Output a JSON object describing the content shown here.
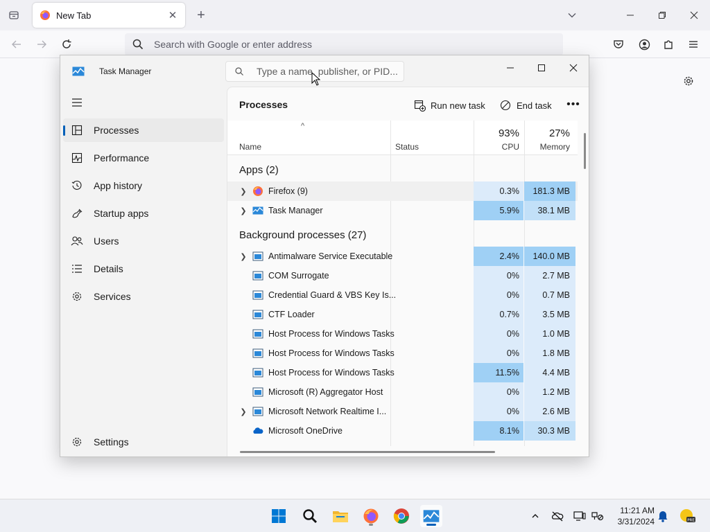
{
  "browser": {
    "tab_title": "New Tab",
    "url_placeholder": "Search with Google or enter address"
  },
  "task_manager": {
    "title": "Task Manager",
    "search_placeholder": "Type a name, publisher, or PID...",
    "nav": [
      {
        "label": "Processes",
        "icon": "processes-icon"
      },
      {
        "label": "Performance",
        "icon": "performance-icon"
      },
      {
        "label": "App history",
        "icon": "app-history-icon"
      },
      {
        "label": "Startup apps",
        "icon": "startup-apps-icon"
      },
      {
        "label": "Users",
        "icon": "users-icon"
      },
      {
        "label": "Details",
        "icon": "details-icon"
      },
      {
        "label": "Services",
        "icon": "services-icon"
      }
    ],
    "settings_label": "Settings",
    "page_title": "Processes",
    "run_new_task": "Run new task",
    "end_task": "End task",
    "columns": {
      "name": "Name",
      "status": "Status",
      "cpu_pct": "93%",
      "cpu": "CPU",
      "memory_pct": "27%",
      "memory": "Memory"
    },
    "groups": {
      "apps": "Apps (2)",
      "background": "Background processes (27)"
    },
    "apps": [
      {
        "name": "Firefox (9)",
        "cpu": "0.3%",
        "mem": "181.3 MB",
        "icon": "firefox-icon",
        "expandable": true
      },
      {
        "name": "Task Manager",
        "cpu": "5.9%",
        "mem": "38.1 MB",
        "icon": "task-manager-icon",
        "expandable": true
      }
    ],
    "background": [
      {
        "name": "Antimalware Service Executable",
        "cpu": "2.4%",
        "mem": "140.0 MB",
        "expandable": true
      },
      {
        "name": "COM Surrogate",
        "cpu": "0%",
        "mem": "2.7 MB",
        "expandable": false
      },
      {
        "name": "Credential Guard & VBS Key Is...",
        "cpu": "0%",
        "mem": "0.7 MB",
        "expandable": false
      },
      {
        "name": "CTF Loader",
        "cpu": "0.7%",
        "mem": "3.5 MB",
        "expandable": false
      },
      {
        "name": "Host Process for Windows Tasks",
        "cpu": "0%",
        "mem": "1.0 MB",
        "expandable": false
      },
      {
        "name": "Host Process for Windows Tasks",
        "cpu": "0%",
        "mem": "1.8 MB",
        "expandable": false
      },
      {
        "name": "Host Process for Windows Tasks",
        "cpu": "11.5%",
        "mem": "4.4 MB",
        "expandable": false
      },
      {
        "name": "Microsoft (R) Aggregator Host",
        "cpu": "0%",
        "mem": "1.2 MB",
        "expandable": false
      },
      {
        "name": "Microsoft Network Realtime I...",
        "cpu": "0%",
        "mem": "2.6 MB",
        "expandable": true
      },
      {
        "name": "Microsoft OneDrive",
        "cpu": "8.1%",
        "mem": "30.3 MB",
        "expandable": false
      }
    ]
  },
  "taskbar": {
    "time": "11:21 AM",
    "date": "3/31/2024"
  },
  "colors": {
    "accent": "#005fb8",
    "heat_light": "#dcebfa",
    "heat_mid": "#c2e0f8",
    "heat_strong": "#9fd0f5"
  }
}
